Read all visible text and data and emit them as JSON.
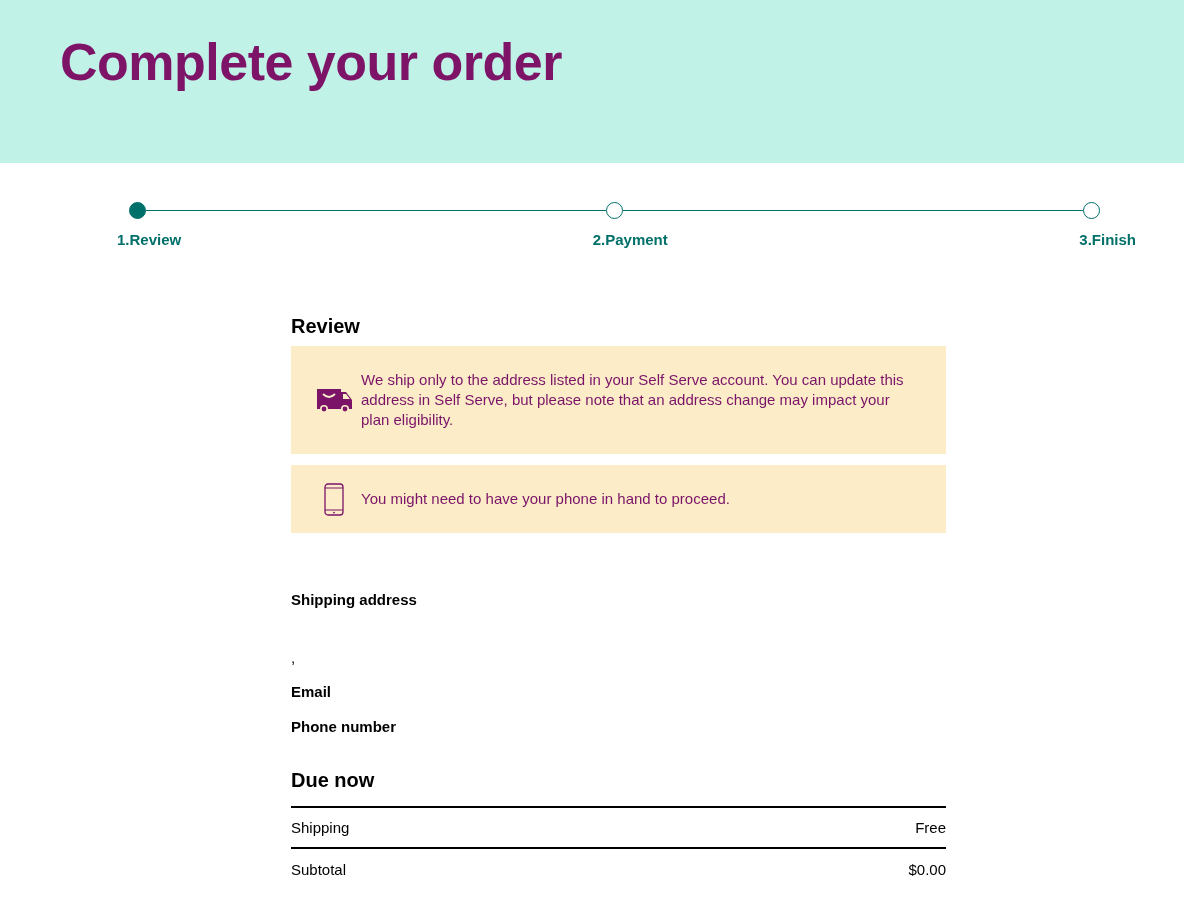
{
  "header": {
    "title": "Complete your order"
  },
  "steps": [
    {
      "label": "1.Review",
      "selected": true
    },
    {
      "label": "2.Payment",
      "selected": false
    },
    {
      "label": "3.Finish",
      "selected": false
    }
  ],
  "review": {
    "title": "Review",
    "notices": [
      {
        "kind": "truck",
        "text": "We ship only to the address listed in your Self Serve account. You can update this address in Self Serve, but please note that an address change may impact your plan eligibility."
      },
      {
        "kind": "phone",
        "text": "You might need to have your phone in hand to proceed."
      }
    ]
  },
  "details": [
    {
      "kind": "label",
      "text": "Shipping address"
    },
    {
      "kind": "address_line",
      "text": ","
    },
    {
      "kind": "label",
      "text": "Email"
    },
    {
      "kind": "label",
      "text": "Phone number"
    }
  ],
  "due_now": {
    "title": "Due now",
    "rows": [
      {
        "label": "Shipping",
        "value": "Free"
      },
      {
        "label": "Subtotal",
        "value": "$0.00"
      }
    ]
  }
}
